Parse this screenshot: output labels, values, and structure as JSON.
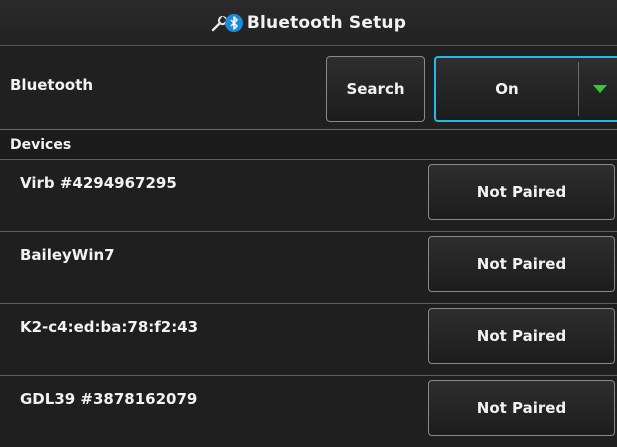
{
  "header": {
    "title": "Bluetooth Setup",
    "icons": [
      "wrench-icon",
      "bluetooth-icon"
    ]
  },
  "bluetooth": {
    "label": "Bluetooth",
    "search_label": "Search",
    "state_value": "On"
  },
  "devices": {
    "header": "Devices",
    "items": [
      {
        "name": "Virb #4294967295",
        "status": "Not Paired"
      },
      {
        "name": "BaileyWin7",
        "status": "Not Paired"
      },
      {
        "name": "K2-c4:ed:ba:78:f2:43",
        "status": "Not Paired"
      },
      {
        "name": "GDL39 #3878162079",
        "status": "Not Paired"
      }
    ]
  },
  "colors": {
    "accent": "#25b9e8",
    "arrow": "#35c83a",
    "bluetooth": "#1e8bd6"
  }
}
